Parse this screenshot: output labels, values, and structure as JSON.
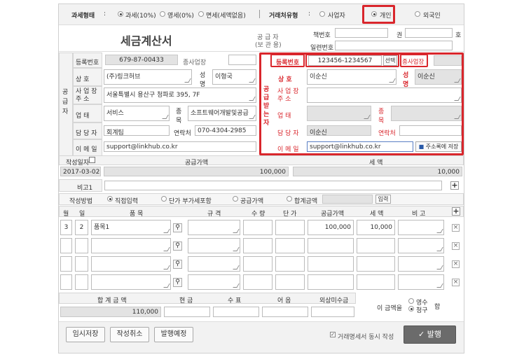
{
  "top": {
    "tax_type_label": "과세형태",
    "tax_type_sep": ":",
    "tax_options": [
      "과세(10%)",
      "영세(0%)",
      "면세(세액없음)"
    ],
    "partner_type_label": "거래처유형",
    "partner_sep": ":",
    "partner_options": [
      "사업자",
      "개인",
      "외국인"
    ]
  },
  "doc": {
    "title": "세금계산서",
    "supplier_caption_1": "공 급 자",
    "supplier_caption_2": "(보 관 용)",
    "book_no_label": "책번호",
    "book_gwon": "권",
    "book_ho": "호",
    "serial_label": "일련번호"
  },
  "supplier": {
    "side_label": [
      "공",
      "급",
      "자"
    ],
    "reg_no_label": "등록번호",
    "reg_no": "679-87-00433",
    "branch_label": "종사업장",
    "name_label": "상    호",
    "name": "(주)링크허브",
    "rep_label_1": "성",
    "rep_label_2": "명",
    "rep": "이형국",
    "addr_label_1": "사 업 장",
    "addr_label_2": "주     소",
    "addr": "서울특별시 용산구 청파로 395, 7F",
    "biz_type_label": "업     태",
    "biz_type": "서비스",
    "biz_item_label_1": "종",
    "biz_item_label_2": "목",
    "biz_item": "소프트웨어개발및공급",
    "contact_label": "담 당 자",
    "contact": "회계팀",
    "phone_label": "연락처",
    "phone": "070-4304-2985",
    "email_label": "이 메 일",
    "email": "support@linkhub.co.kr"
  },
  "buyer": {
    "side_label": [
      "공",
      "급",
      "받",
      "는",
      "자"
    ],
    "reg_no_label": "등록번호",
    "reg_no": "123456-1234567",
    "select_button": "선택",
    "branch_label": "종사업장",
    "name_label": "상    호",
    "name": "이순신",
    "rep_label_1": "성",
    "rep_label_2": "명",
    "rep": "이순신",
    "addr_label_1": "사 업 장",
    "addr_label_2": "주     소",
    "biz_type_label": "업     태",
    "biz_item_label_1": "종",
    "biz_item_label_2": "목",
    "contact_label": "담 당 자",
    "contact": "이순신",
    "phone_label": "연락처",
    "email_label": "이 메 일",
    "email": "support@linkhub.co.kr",
    "save_contact_button": "주소록에 저장"
  },
  "summary": {
    "date_label": "작성일자",
    "date": "2017-03-02",
    "supply_label": "공급가액",
    "supply": "100,000",
    "tax_label": "세     액",
    "tax": "10,000",
    "remark_label": "비고1"
  },
  "method": {
    "label": "작성방법",
    "options": [
      "직접입력",
      "단가 부가세포함",
      "공급가액",
      "합계금액"
    ],
    "input_button": "입력"
  },
  "items": {
    "headers": [
      "월",
      "일",
      "품     목",
      "규     격",
      "수  량",
      "단  가",
      "공급가액",
      "세     액",
      "비     고"
    ],
    "rows": [
      {
        "month": "3",
        "day": "2",
        "item": "품목1",
        "spec": "",
        "qty": "",
        "price": "",
        "supply": "100,000",
        "tax": "10,000",
        "note": ""
      },
      {
        "month": "",
        "day": "",
        "item": "",
        "spec": "",
        "qty": "",
        "price": "",
        "supply": "",
        "tax": "",
        "note": ""
      },
      {
        "month": "",
        "day": "",
        "item": "",
        "spec": "",
        "qty": "",
        "price": "",
        "supply": "",
        "tax": "",
        "note": ""
      },
      {
        "month": "",
        "day": "",
        "item": "",
        "spec": "",
        "qty": "",
        "price": "",
        "supply": "",
        "tax": "",
        "note": ""
      }
    ]
  },
  "totals": {
    "total_label": "합 계 금 액",
    "total": "110,000",
    "cash_label": "현     금",
    "check_label": "수     표",
    "note_label": "어     음",
    "credit_label": "외상미수금",
    "amount_label": "이 금액을",
    "receipt_opt": "영수",
    "claim_opt": "청구",
    "ham": "함"
  },
  "footer": {
    "temp_save": "임시저장",
    "cancel": "작성취소",
    "schedule": "발행예정",
    "checkbox_label": "거래명세서 동시 작성",
    "issue": "발행"
  }
}
